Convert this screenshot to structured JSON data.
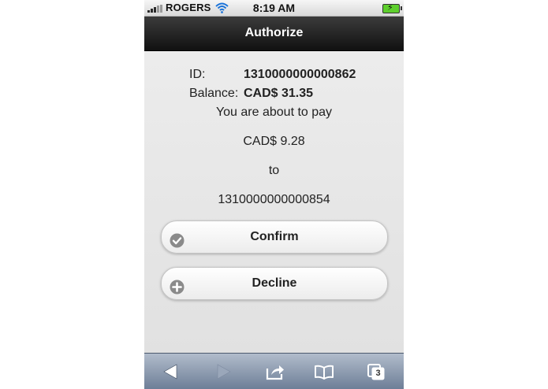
{
  "status_bar": {
    "carrier": "ROGERS",
    "time": "8:19 AM"
  },
  "header": {
    "title": "Authorize"
  },
  "account": {
    "id_label": "ID:",
    "id_value": "1310000000000862",
    "balance_label": "Balance:",
    "balance_value": "CAD$ 31.35"
  },
  "payment": {
    "intro": "You are about to pay",
    "amount": "CAD$ 9.28",
    "to_label": "to",
    "recipient": "1310000000000854"
  },
  "buttons": {
    "confirm_label": "Confirm",
    "decline_label": "Decline"
  },
  "toolbar": {
    "icons": [
      "back-arrow-icon",
      "forward-arrow-icon",
      "share-icon",
      "bookmarks-icon",
      "tabs-icon"
    ],
    "tabs_count": "3"
  },
  "colors": {
    "header_bg": "#1f1f1f",
    "content_bg": "#e7e7e7",
    "toolbar_bg": "#8d9bb0",
    "button_icon": "#8a8a8a"
  }
}
